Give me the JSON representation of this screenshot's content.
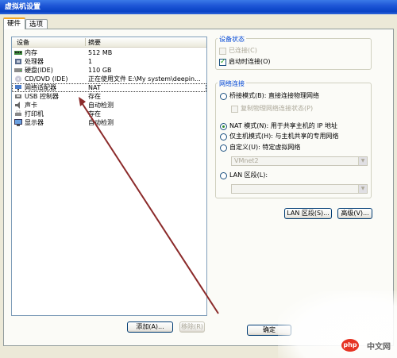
{
  "window": {
    "title": "虚拟机设置"
  },
  "tabs": [
    {
      "label": "硬件"
    },
    {
      "label": "选项"
    }
  ],
  "device_list": {
    "headers": {
      "device": "设备",
      "summary": "摘要"
    },
    "rows": [
      {
        "icon": "memory-icon",
        "name": "内存",
        "summary": "512 MB"
      },
      {
        "icon": "processor-icon",
        "name": "处理器",
        "summary": "1"
      },
      {
        "icon": "hard-disk-icon",
        "name": "硬盘(IDE)",
        "summary": "110 GB"
      },
      {
        "icon": "cd-dvd-icon",
        "name": "CD/DVD (IDE)",
        "summary": "正在使用文件 E:\\My system\\deepin..."
      },
      {
        "icon": "network-adapter-icon",
        "name": "网络适配器",
        "summary": "NAT"
      },
      {
        "icon": "usb-controller-icon",
        "name": "USB 控制器",
        "summary": "存在"
      },
      {
        "icon": "sound-card-icon",
        "name": "声卡",
        "summary": "自动检测"
      },
      {
        "icon": "printer-icon",
        "name": "打印机",
        "summary": "存在"
      },
      {
        "icon": "display-icon",
        "name": "显示器",
        "summary": "自动检测"
      }
    ],
    "selected_row": "网络适配器"
  },
  "buttons": {
    "add": "添加(A)...",
    "remove": "移除(R)",
    "lan_segments": "LAN 区段(S)...",
    "advanced": "高级(V)...",
    "ok": "确定"
  },
  "device_status": {
    "title": "设备状态",
    "connected": {
      "label": "已连接(C)",
      "checked": false,
      "enabled": false
    },
    "connect_at_power_on": {
      "label": "启动时连接(O)",
      "checked": true,
      "enabled": true
    }
  },
  "network_connection": {
    "title": "网络连接",
    "options": [
      {
        "id": "bridged",
        "label": "桥接模式(B): 直接连接物理网络",
        "selected": false
      },
      {
        "id": "nat",
        "label": "NAT 模式(N): 用于共享主机的 IP 地址",
        "selected": true
      },
      {
        "id": "host-only",
        "label": "仅主机模式(H): 与主机共享的专用网络",
        "selected": false
      },
      {
        "id": "custom",
        "label": "自定义(U): 特定虚拟网络",
        "selected": false
      },
      {
        "id": "lan-segment",
        "label": "LAN 区段(L):",
        "selected": false
      }
    ],
    "replicate_state": {
      "label": "复制物理网络连接状态(P)",
      "checked": false,
      "enabled": false
    },
    "custom_dropdown_value": "VMnet2",
    "lan_dropdown_value": ""
  },
  "watermark": {
    "logo": "php",
    "text": "中文网"
  },
  "colors": {
    "titlebar": "#0842c5",
    "group_title": "#0046d5",
    "annotation_arrow": "#8b2a2a"
  }
}
